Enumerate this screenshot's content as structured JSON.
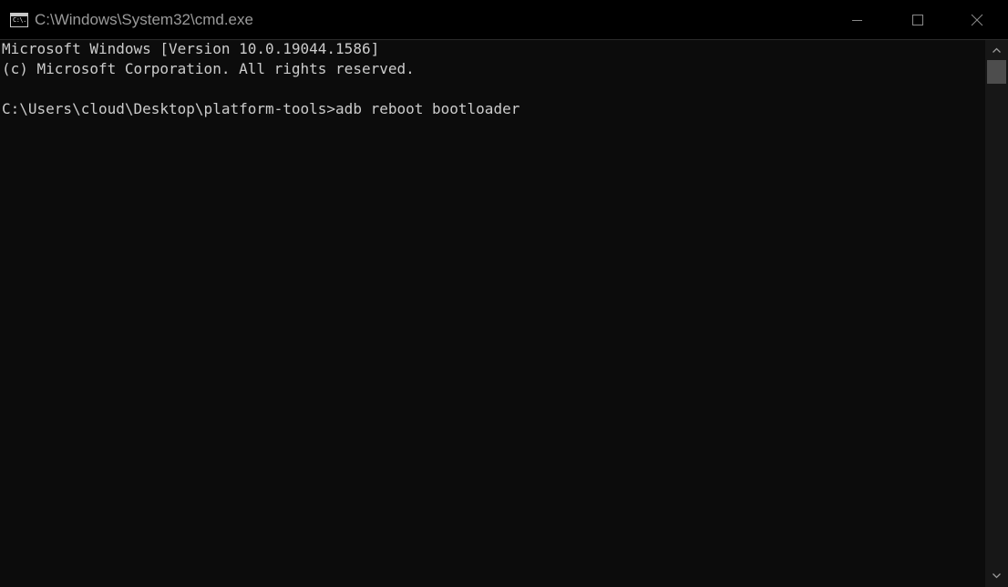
{
  "window": {
    "title": "C:\\Windows\\System32\\cmd.exe",
    "icon": "cmd-icon",
    "icon_text": "C:\\."
  },
  "console": {
    "lines": [
      "Microsoft Windows [Version 10.0.19044.1586]",
      "(c) Microsoft Corporation. All rights reserved.",
      "",
      "C:\\Users\\cloud\\Desktop\\platform-tools>adb reboot bootloader"
    ],
    "foreground": "#cccccc",
    "background": "#0c0c0c"
  },
  "controls": {
    "minimize": "minimize-icon",
    "maximize": "maximize-icon",
    "close": "close-icon"
  }
}
